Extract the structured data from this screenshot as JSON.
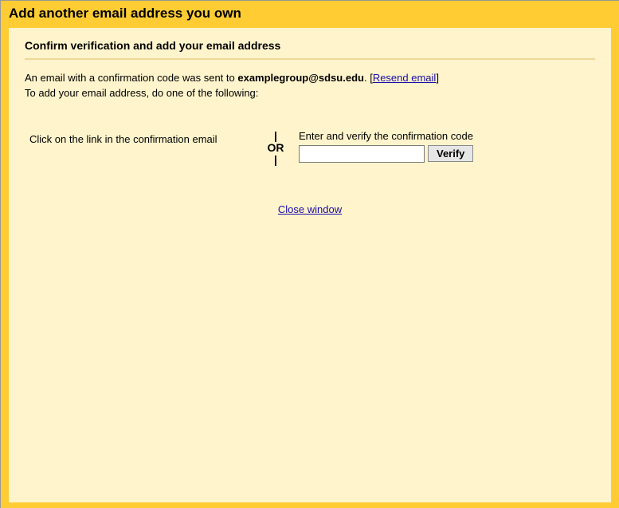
{
  "titleBar": "Add another email address you own",
  "subHeader": "Confirm verification and add your email address",
  "message": {
    "line1_pre": "An email with a confirmation code was sent to ",
    "email": "examplegroup@sdsu.edu",
    "line1_post": ". [",
    "resend": "Resend email",
    "line1_end": "]",
    "line2": "To add your email address, do one of the following:"
  },
  "options": {
    "left": "Click on the link in the confirmation email",
    "or": "OR",
    "right_label": "Enter and verify the confirmation code",
    "verify": "Verify"
  },
  "closeWindow": "Close window"
}
